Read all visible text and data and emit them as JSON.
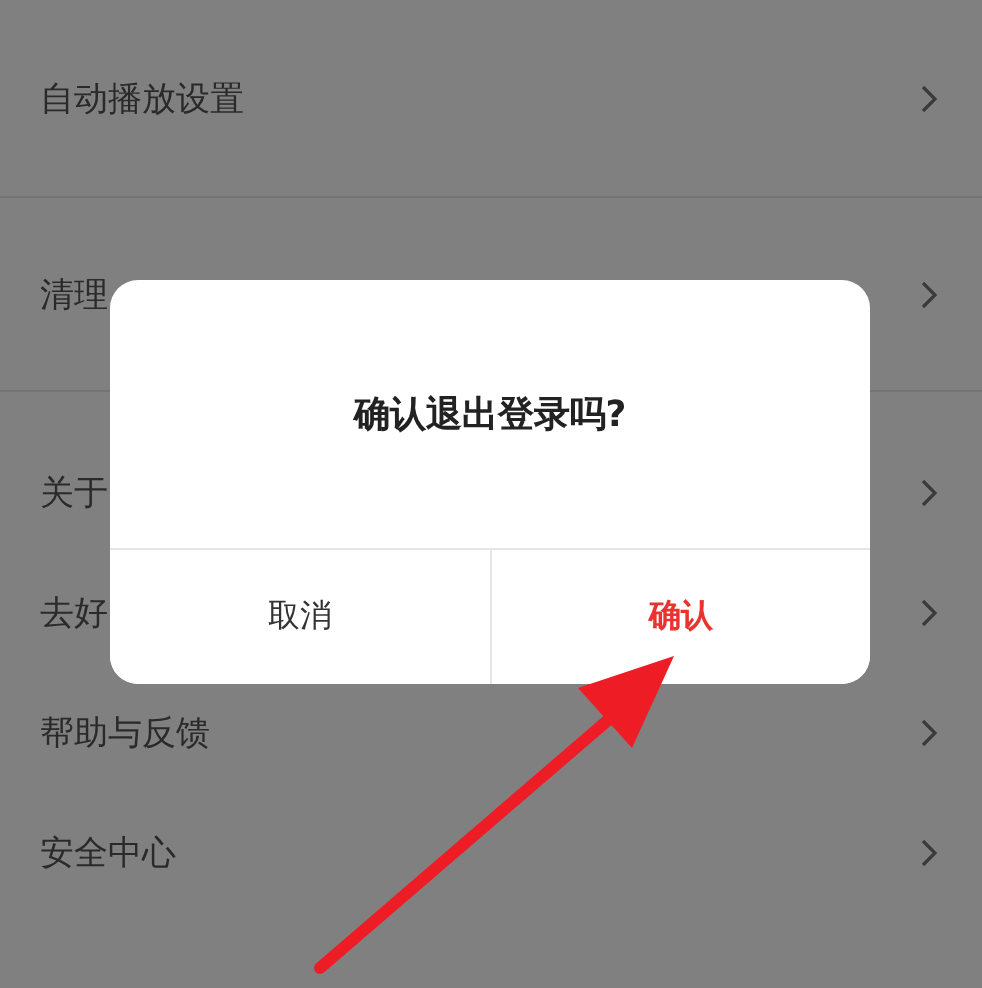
{
  "settings_groups": [
    {
      "items": [
        {
          "label": "自动播放设置"
        }
      ]
    },
    {
      "items": [
        {
          "label": "清理"
        }
      ]
    },
    {
      "items": [
        {
          "label": "关于"
        },
        {
          "label": "去好"
        },
        {
          "label": "帮助与反馈"
        },
        {
          "label": "安全中心"
        }
      ]
    }
  ],
  "dialog": {
    "title": "确认退出登录吗?",
    "buttons": [
      {
        "label": "取消",
        "kind": "cancel"
      },
      {
        "label": "确认",
        "kind": "confirm"
      }
    ]
  }
}
